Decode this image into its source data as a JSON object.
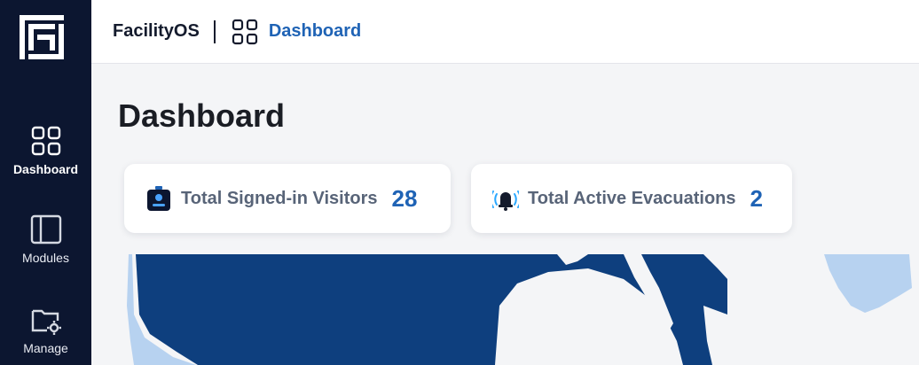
{
  "app": {
    "name": "FacilityOS"
  },
  "breadcrumb": {
    "current": "Dashboard"
  },
  "sidebar": {
    "items": [
      {
        "label": "Dashboard",
        "icon": "grid-icon",
        "active": true
      },
      {
        "label": "Modules",
        "icon": "panel-icon",
        "active": false
      },
      {
        "label": "Manage",
        "icon": "folder-gear-icon",
        "active": false
      }
    ]
  },
  "page": {
    "title": "Dashboard"
  },
  "stats": [
    {
      "label": "Total Signed-in Visitors",
      "value": "28",
      "icon": "badge-icon"
    },
    {
      "label": "Total Active Evacuations",
      "value": "2",
      "icon": "alarm-bell-icon"
    }
  ],
  "colors": {
    "sidebar": "#0c1630",
    "accent": "#1f63b5",
    "map_ocean": "#0e3f7e",
    "map_land": "#f4f5f7",
    "map_light": "#b7d2f0"
  }
}
